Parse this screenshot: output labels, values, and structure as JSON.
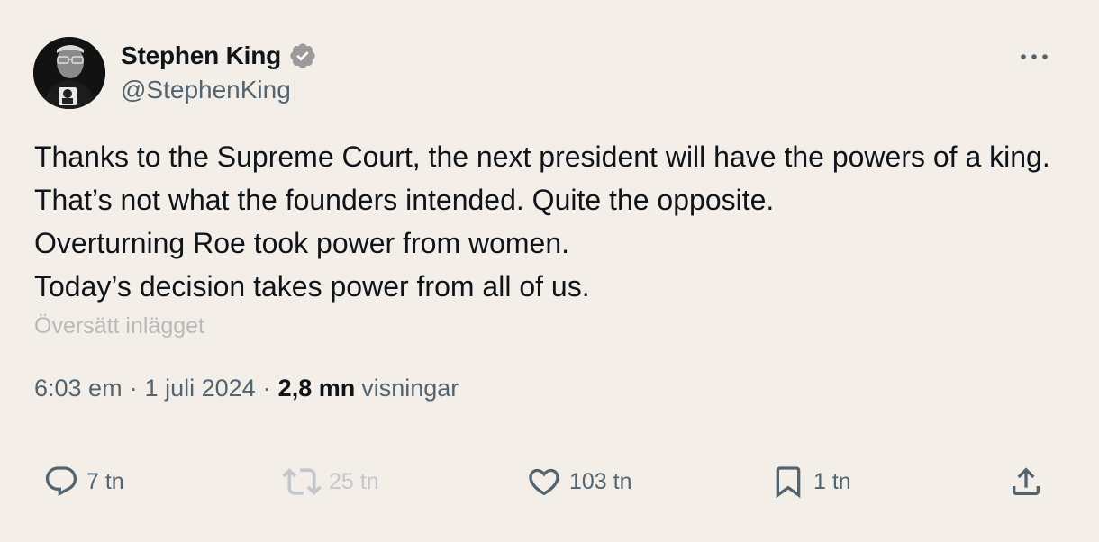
{
  "author": {
    "name": "Stephen King",
    "handle": "@StephenKing"
  },
  "tweet": {
    "text": "Thanks to the Supreme Court, the next president will have the powers of a king. That’s not what the founders intended. Quite the opposite.\nOverturning Roe took power from women.\nToday’s decision takes power from all of us.",
    "translate_label": "Översätt inlägget",
    "time": "6:03 em",
    "separator": "·",
    "date": "1 juli 2024",
    "views_count": "2,8 mn",
    "views_label": "visningar"
  },
  "actions": {
    "reply_count": "7 tn",
    "retweet_count": "25 tn",
    "like_count": "103 tn",
    "bookmark_count": "1 tn"
  },
  "colors": {
    "background": "#f3efe8",
    "text": "#0f1419",
    "muted": "#536471",
    "disabled": "#c3c7cb",
    "verified_badge": "#9a9a9a"
  },
  "icons": {
    "verified": "verified-badge-icon",
    "more": "more-horizontal-icon",
    "reply": "reply-icon",
    "retweet": "retweet-icon",
    "like": "heart-icon",
    "bookmark": "bookmark-icon",
    "share": "share-icon"
  }
}
